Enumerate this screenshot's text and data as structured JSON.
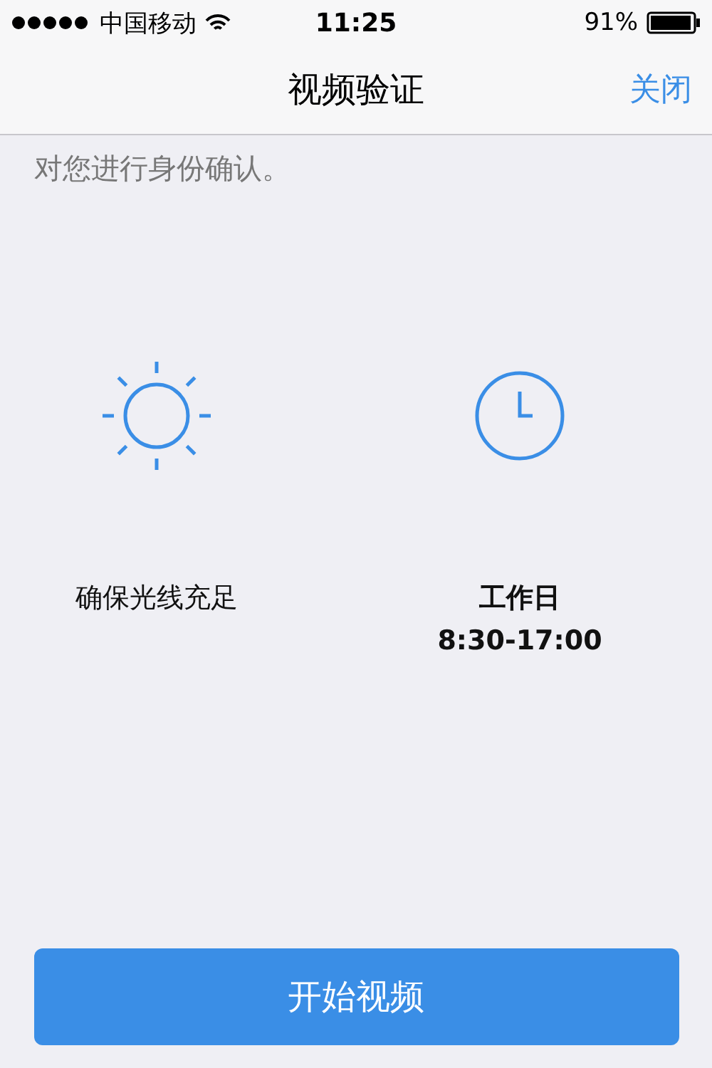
{
  "status_bar": {
    "carrier": "中国移动",
    "time": "11:25",
    "battery": "91%"
  },
  "nav": {
    "title": "视频验证",
    "action": "关闭"
  },
  "intro": "对您进行身份确认。",
  "tips": [
    {
      "kind": "light",
      "lines": [
        "确保光线充足"
      ]
    },
    {
      "kind": "time",
      "lines": [
        "工作日",
        "8:30-17:00"
      ]
    }
  ],
  "button": "开始视频"
}
